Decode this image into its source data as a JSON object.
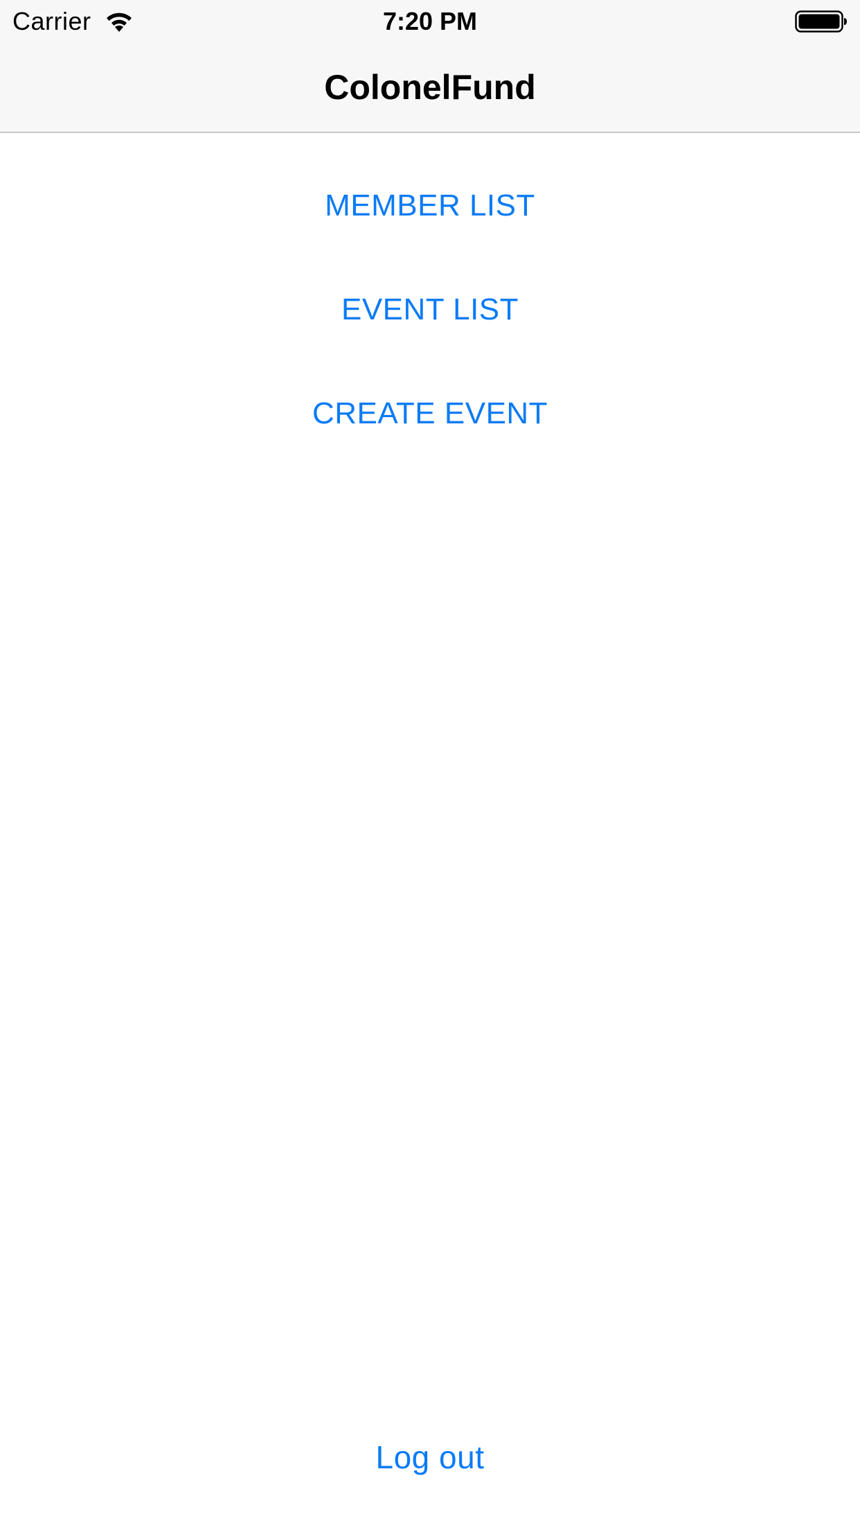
{
  "status_bar": {
    "carrier": "Carrier",
    "time": "7:20 PM",
    "wifi_icon": "wifi-icon",
    "battery_icon": "battery-icon"
  },
  "nav": {
    "title": "ColonelFund"
  },
  "menu": {
    "member_list": "MEMBER LIST",
    "event_list": "EVENT LIST",
    "create_event": "CREATE EVENT"
  },
  "footer": {
    "logout": "Log out"
  },
  "colors": {
    "accent": "#0a7bf5",
    "nav_background": "#f7f7f7",
    "separator": "#c8c8cc"
  }
}
